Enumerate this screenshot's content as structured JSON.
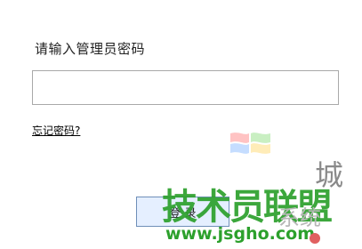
{
  "dialog": {
    "prompt": "请输入管理员密码",
    "password_value": "",
    "forgot_link": "忘记密码?",
    "login_button": "登 录"
  },
  "watermark": {
    "text": "技术员联盟",
    "url": "www.jsgho.com",
    "side_text": "系统",
    "side_text2": "城",
    "icon": "windows-flag-logo",
    "colors": {
      "green": "#2ca02c",
      "gray": "#8a8a8a"
    }
  }
}
